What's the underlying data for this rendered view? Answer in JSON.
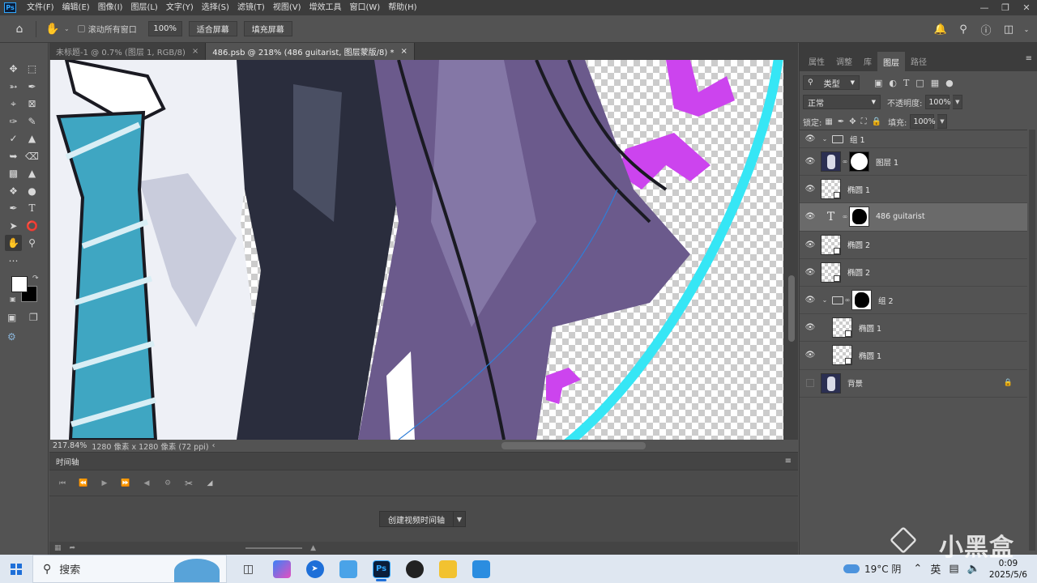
{
  "menu": {
    "logo": "Ps",
    "items": [
      "文件(F)",
      "编辑(E)",
      "图像(I)",
      "图层(L)",
      "文字(Y)",
      "选择(S)",
      "滤镜(T)",
      "视图(V)",
      "增效工具",
      "窗口(W)",
      "帮助(H)"
    ]
  },
  "options": {
    "scroll_all_label": "滚动所有窗口",
    "zoom_value": "100%",
    "fit_screen_label": "适合屏幕",
    "fill_screen_label": "填充屏幕"
  },
  "doc_tabs": [
    {
      "label": "未标题-1 @ 0.7% (图层 1, RGB/8)",
      "close": "×",
      "active": false
    },
    {
      "label": "486.psb @ 218% (486    guitarist, 图层蒙版/8) *",
      "close": "×",
      "active": true
    }
  ],
  "status": {
    "zoom": "217.84%",
    "doc_info": "1280 像素 x 1280 像素 (72 ppi)",
    "arrow": "‹"
  },
  "timeline": {
    "title": "时间轴",
    "create_button": "创建视频时间轴"
  },
  "panel": {
    "tabs": [
      "属性",
      "调整",
      "库",
      "图层",
      "路径"
    ],
    "active_tab": "图层",
    "filter_kind": "类型",
    "blend_mode": "正常",
    "opacity_label": "不透明度:",
    "opacity_value": "100%",
    "lock_label": "锁定:",
    "fill_label": "填充:",
    "fill_value": "100%"
  },
  "layers": [
    {
      "name": "组 1"
    },
    {
      "name": "图层 1"
    },
    {
      "name": "椭圆 1"
    },
    {
      "name": "486    guitarist"
    },
    {
      "name": "椭圆 2"
    },
    {
      "name": "椭圆 2"
    },
    {
      "name": "组 2"
    },
    {
      "name": "椭圆 1"
    },
    {
      "name": "椭圆 1"
    },
    {
      "name": "背景"
    }
  ],
  "taskbar": {
    "search_label": "搜索",
    "weather": "19°C 阴",
    "ime": "英",
    "time": "0:09",
    "date": "2025/5/6",
    "watermark": "小黑盒"
  },
  "colors": {
    "accent": "#31a8ff",
    "cyan_ring": "#36e6f5",
    "magenta_text": "#cc44ee",
    "hair_purple": "#6b5a8c",
    "tie_teal": "#3fa6c2"
  }
}
